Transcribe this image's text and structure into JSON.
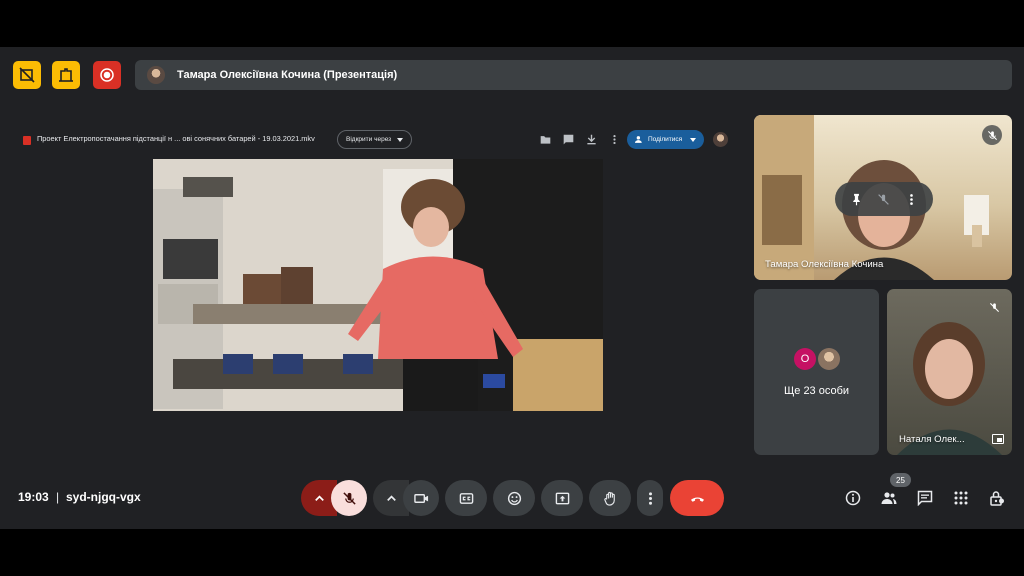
{
  "presenter": {
    "name": "Тамара Олексіївна Кочина (Презентація)"
  },
  "presentation": {
    "file_title": "Проект Електропостачання підстанції н ... ові сонячних батарей - 19.03.2021.mkv",
    "open_with_label": "Відкрити через",
    "share_label": "Поділитися"
  },
  "tiles": {
    "tamara": {
      "name": "Тамара Олексіївна Кочина"
    },
    "more": {
      "avatar_letter": "О",
      "label": "Ще 23 особи"
    },
    "natalia": {
      "name": "Наталя Олек..."
    }
  },
  "meeting": {
    "time": "19:03",
    "separator": "|",
    "code": "syd-njgq-vgx"
  },
  "people_count": "25",
  "colors": {
    "background": "#202124",
    "surface": "#3c4043",
    "hangup": "#ea4335",
    "mic_off_bg": "#f9dedc",
    "mic_arrow_bg": "#8c1d18",
    "top_yellow": "#fbbc04",
    "top_red": "#d93025",
    "share_blue": "#1a5e9c"
  }
}
